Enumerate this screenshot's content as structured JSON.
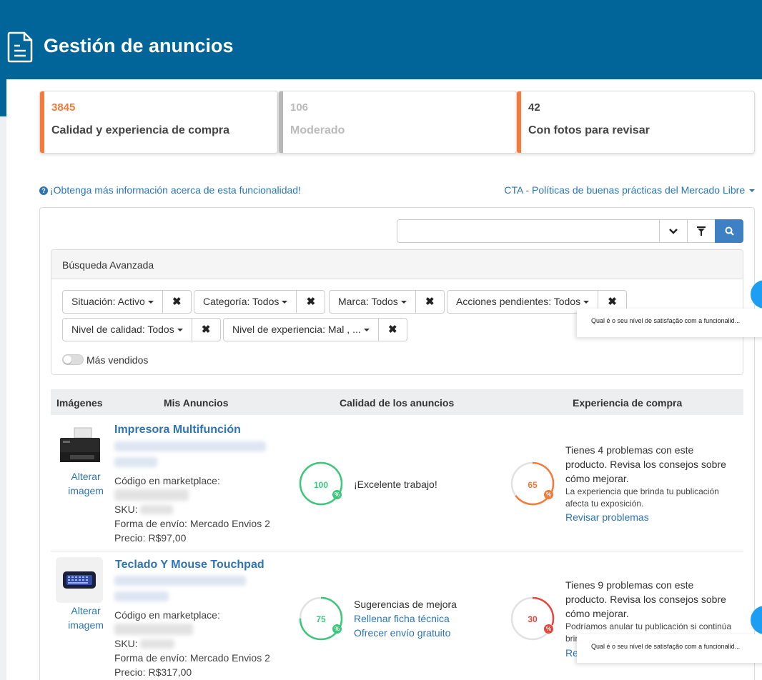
{
  "header": {
    "title": "Gestión de anuncios",
    "icon": "document-icon",
    "color": "#02659a"
  },
  "cards": [
    {
      "count": "3845",
      "label": "Calidad y experiencia de compra",
      "accent": "#f47b3a",
      "state": "active"
    },
    {
      "count": "106",
      "label": "Moderado",
      "accent": "#b8b8b8",
      "state": "disabled"
    },
    {
      "count": "42",
      "label": "Con fotos para revisar",
      "accent": "#f47b3a",
      "state": "normal"
    }
  ],
  "links": {
    "info": "¡Obtenga más información acerca de esta funcionalidad!",
    "cta": "CTA - Políticas de buenas prácticas del Mercado Libre"
  },
  "search": {
    "value": "",
    "placeholder": ""
  },
  "advanced": {
    "title": "Búsqueda Avanzada",
    "filters": [
      {
        "label": "Situación: Activo"
      },
      {
        "label": "Categoría: Todos"
      },
      {
        "label": "Marca: Todos"
      },
      {
        "label": "Acciones pendientes: Todos"
      },
      {
        "label": "Nivel de calidad: Todos"
      },
      {
        "label": "Nivel de experiencia: Mal , ..."
      }
    ],
    "toggle_label": "Más vendidos",
    "toggle_on": false
  },
  "table": {
    "headers": [
      "Imágenes",
      "Mis Anuncios",
      "Calidad de los anuncios",
      "Experiencia de compra"
    ],
    "rows": [
      {
        "image_action": "Alterar imagem",
        "title": "Impresora Multifunción",
        "marketplace_label": "Código en marketplace:",
        "sku_label": "SKU:",
        "shipping": "Forma de envío: Mercado Envios 2",
        "price": "Precio: R$97,00",
        "quality_score": 100,
        "quality_color": "#3cc77b",
        "quality_text": "¡Excelente trabajo!",
        "quality_links": [],
        "experience_score": 65,
        "experience_color": "#f47b3a",
        "experience_text": "Tienes 4 problemas con este producto. Revisa los consejos sobre cómo mejorar.",
        "experience_note": "La experiencia que brinda tu publicación afecta tu exposición.",
        "experience_link": "Revisar problemas"
      },
      {
        "image_action": "Alterar imagem",
        "title": "Teclado Y Mouse Touchpad",
        "marketplace_label": "Código en marketplace:",
        "sku_label": "SKU:",
        "shipping": "Forma de envío: Mercado Envios 2",
        "price": "Precio: R$317,00",
        "quality_score": 75,
        "quality_color": "#3cc77b",
        "quality_text": "Sugerencias de mejora",
        "quality_links": [
          "Rellenar ficha técnica",
          "Ofrecer envío gratuito"
        ],
        "experience_score": 30,
        "experience_color": "#e8453c",
        "experience_text": "Tienes 9 problemas con este producto. Revisa los consejos sobre cómo mejorar.",
        "experience_note": "Podríamos anular tu publicación si continúa brin",
        "experience_link": "Re"
      }
    ]
  },
  "satisfaction_popup": "Qual é o seu nível de satisfação com a funcionalid..."
}
